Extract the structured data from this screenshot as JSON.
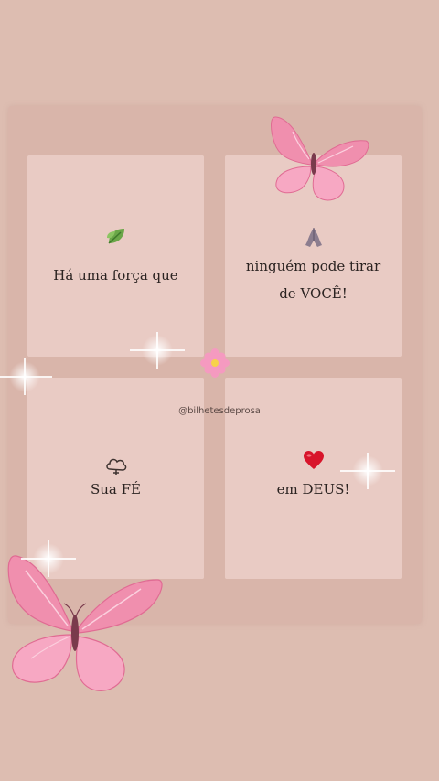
{
  "cards": [
    {
      "icon": "leaf-icon",
      "lines": [
        "Há uma força que"
      ]
    },
    {
      "icon": "praying-hands-icon",
      "lines": [
        "ninguém pode tirar",
        "de VOCÊ!"
      ]
    },
    {
      "icon": "cloud-icon",
      "lines": [
        "Sua FÉ"
      ]
    },
    {
      "icon": "heart-icon",
      "lines": [
        "em DEUS!"
      ]
    }
  ],
  "handle": "@bilhetesdeprosa",
  "colors": {
    "background": "#ddbdb1",
    "card": "#e9cbc4",
    "butterfly": "#f08fae",
    "heart": "#d8152b"
  }
}
